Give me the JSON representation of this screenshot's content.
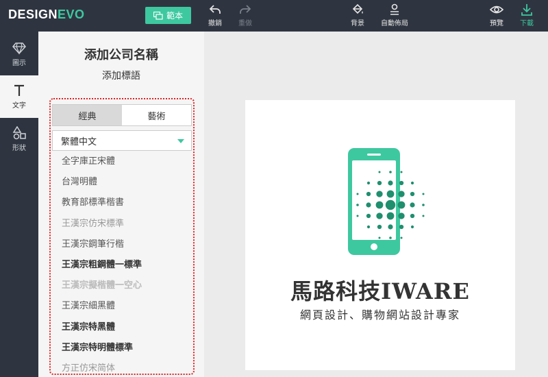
{
  "app": {
    "logo_design": "DESIGN",
    "logo_evo": "EVO"
  },
  "toolbar": {
    "template_label": "範本",
    "undo_label": "撤銷",
    "redo_label": "重做",
    "background_label": "背景",
    "auto_layout_label": "自動佈局",
    "preview_label": "預覽",
    "download_label": "下載"
  },
  "sidebar": {
    "items": [
      {
        "label": "圖示",
        "icon": "diamond-icon"
      },
      {
        "label": "文字",
        "icon": "text-icon"
      },
      {
        "label": "形狀",
        "icon": "shapes-icon"
      }
    ]
  },
  "panel": {
    "add_company_name": "添加公司名稱",
    "add_tagline": "添加標語",
    "tabs": [
      "經典",
      "藝術"
    ],
    "active_tab": "經典",
    "language": "繁體中文",
    "fonts": [
      "全字庫正宋體",
      "台灣明體",
      "教育部標準楷書",
      "王漢宗仿宋標準",
      "王漢宗鋼筆行楷",
      "王漢宗粗鋼體一標準",
      "王漢宗擬楷體一空心",
      "王漢宗細黑體",
      "王漢宗特黑體",
      "王漢宗特明體標準",
      "方正仿宋简体"
    ]
  },
  "canvas": {
    "company_name": "馬路科技IWARE",
    "slogan": "網頁設計、購物網站設計專家",
    "logo_icon": "smartphone-signal-icon",
    "brand_color": "#3ec8a0",
    "dot_color": "#1f8f6e"
  },
  "colors": {
    "accent": "#3ec8a0",
    "dark": "#2f3540"
  }
}
